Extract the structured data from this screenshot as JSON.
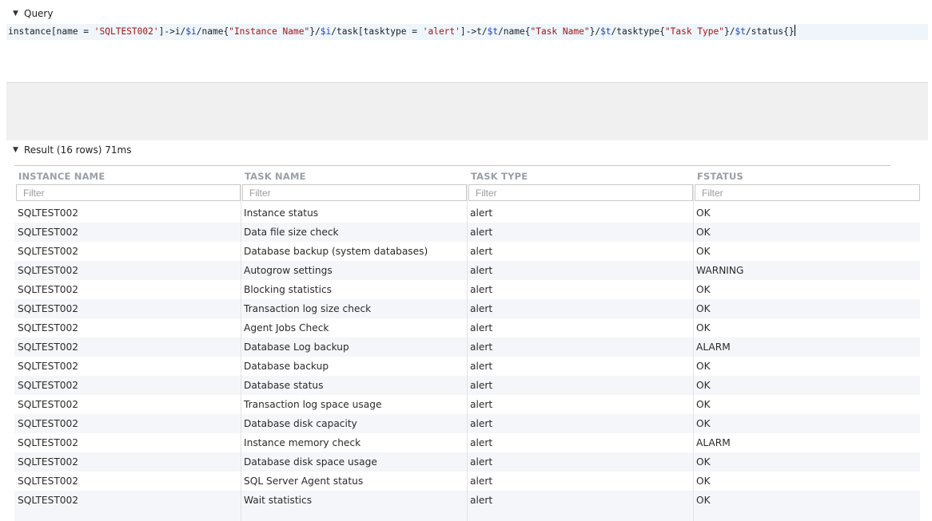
{
  "query_panel": {
    "label": "Query"
  },
  "result_panel": {
    "label": "Result (16 rows) 71ms"
  },
  "columns": [
    "INSTANCE NAME",
    "TASK NAME",
    "TASK TYPE",
    "FSTATUS"
  ],
  "filter_placeholder": "Filter",
  "rows": [
    [
      "SQLTEST002",
      "Instance status",
      "alert",
      "OK"
    ],
    [
      "SQLTEST002",
      "Data file size check",
      "alert",
      "OK"
    ],
    [
      "SQLTEST002",
      "Database backup (system databases)",
      "alert",
      "OK"
    ],
    [
      "SQLTEST002",
      "Autogrow settings",
      "alert",
      "WARNING"
    ],
    [
      "SQLTEST002",
      "Blocking statistics",
      "alert",
      "OK"
    ],
    [
      "SQLTEST002",
      "Transaction log size check",
      "alert",
      "OK"
    ],
    [
      "SQLTEST002",
      "Agent Jobs Check",
      "alert",
      "OK"
    ],
    [
      "SQLTEST002",
      "Database Log backup",
      "alert",
      "ALARM"
    ],
    [
      "SQLTEST002",
      "Database backup",
      "alert",
      "OK"
    ],
    [
      "SQLTEST002",
      "Database status",
      "alert",
      "OK"
    ],
    [
      "SQLTEST002",
      "Transaction log space usage",
      "alert",
      "OK"
    ],
    [
      "SQLTEST002",
      "Database disk capacity",
      "alert",
      "OK"
    ],
    [
      "SQLTEST002",
      "Instance memory check",
      "alert",
      "ALARM"
    ],
    [
      "SQLTEST002",
      "Database disk space usage",
      "alert",
      "OK"
    ],
    [
      "SQLTEST002",
      "SQL Server Agent status",
      "alert",
      "OK"
    ],
    [
      "SQLTEST002",
      "Wait statistics",
      "alert",
      "OK"
    ]
  ],
  "query_tokens": [
    {
      "t": "instance[name = ",
      "c": ""
    },
    {
      "t": "'SQLTEST002'",
      "c": "str"
    },
    {
      "t": "]->i/",
      "c": ""
    },
    {
      "t": "$i",
      "c": "var"
    },
    {
      "t": "/name{",
      "c": ""
    },
    {
      "t": "\"Instance Name\"",
      "c": "str"
    },
    {
      "t": "}/",
      "c": ""
    },
    {
      "t": "$i",
      "c": "var"
    },
    {
      "t": "/task[tasktype = ",
      "c": ""
    },
    {
      "t": "'alert'",
      "c": "str"
    },
    {
      "t": "]->t/",
      "c": ""
    },
    {
      "t": "$t",
      "c": "var"
    },
    {
      "t": "/name{",
      "c": ""
    },
    {
      "t": "\"Task Name\"",
      "c": "str"
    },
    {
      "t": "}/",
      "c": ""
    },
    {
      "t": "$t",
      "c": "var"
    },
    {
      "t": "/tasktype{",
      "c": ""
    },
    {
      "t": "\"Task Type\"",
      "c": "str"
    },
    {
      "t": "}/",
      "c": ""
    },
    {
      "t": "$t",
      "c": "var"
    },
    {
      "t": "/status{}",
      "c": ""
    }
  ],
  "icons": {
    "collapse": "caret-down-icon"
  },
  "colors": {
    "string": "#a31515",
    "variable": "#1f3fb8",
    "stripe": "#f4f6f9",
    "header_text": "#9aa0a6"
  }
}
